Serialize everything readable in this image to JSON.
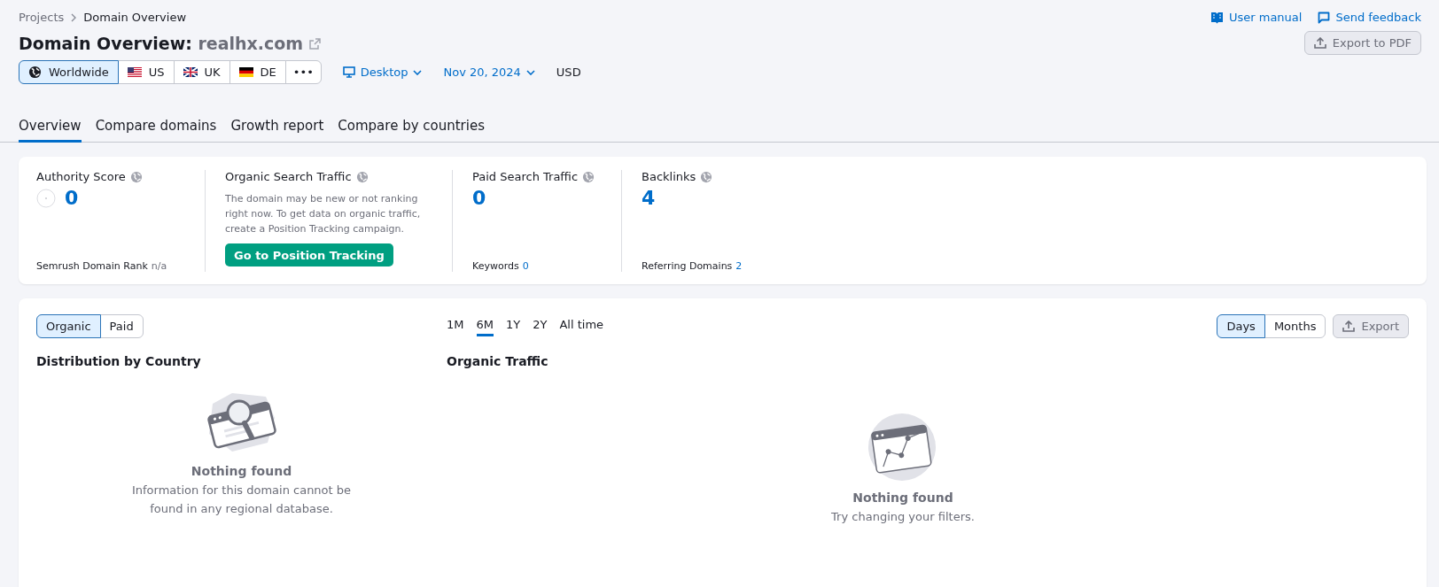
{
  "breadcrumb": [
    "Projects",
    "Domain Overview"
  ],
  "header_links": [
    {
      "label": "User manual",
      "kind": "manual"
    },
    {
      "label": "Send feedback",
      "kind": "feedback"
    }
  ],
  "title": {
    "label": "Domain Overview:",
    "domain": "realhx.com"
  },
  "export_pdf": "Export to PDF",
  "databases": [
    {
      "label": "Worldwide",
      "kind": "globe",
      "selected": true
    },
    {
      "label": "US",
      "kind": "us",
      "selected": false
    },
    {
      "label": "UK",
      "kind": "uk",
      "selected": false
    },
    {
      "label": "DE",
      "kind": "de",
      "selected": false
    },
    {
      "label": "•••",
      "kind": "more",
      "selected": false
    }
  ],
  "device": "Desktop",
  "date": "Nov 20, 2024",
  "currency": "USD",
  "tabs": [
    {
      "label": "Overview",
      "selected": true
    },
    {
      "label": "Compare domains",
      "selected": false
    },
    {
      "label": "Growth report",
      "selected": false
    },
    {
      "label": "Compare by countries",
      "selected": false
    }
  ],
  "metrics": [
    {
      "kind": "score",
      "title": "Authority Score",
      "value": "0",
      "footer_label": "Semrush Domain Rank",
      "footer_value": "n/a",
      "footer_link": false
    },
    {
      "kind": "message",
      "title": "Organic Search Traffic",
      "description": "The domain may be new or not ranking right now. To get data on organic traffic, create a Position Tracking campaign.",
      "button": "Go to Position Tracking"
    },
    {
      "kind": "value",
      "title": "Paid Search Traffic",
      "value": "0",
      "footer_label": "Keywords",
      "footer_value": "0",
      "footer_link": true
    },
    {
      "kind": "value",
      "title": "Backlinks",
      "value": "4",
      "footer_label": "Referring Domains",
      "footer_value": "2",
      "footer_link": true
    }
  ],
  "traffic_types": [
    {
      "label": "Organic",
      "selected": true
    },
    {
      "label": "Paid",
      "selected": false
    }
  ],
  "periods": [
    {
      "label": "1M",
      "selected": false
    },
    {
      "label": "6M",
      "selected": true
    },
    {
      "label": "1Y",
      "selected": false
    },
    {
      "label": "2Y",
      "selected": false
    },
    {
      "label": "All time",
      "selected": false
    }
  ],
  "granularity": [
    {
      "label": "Days",
      "selected": true
    },
    {
      "label": "Months",
      "selected": false
    }
  ],
  "export": "Export",
  "sections": [
    {
      "kind": "map",
      "title": "Distribution by Country",
      "empty_title": "Nothing found",
      "empty_text": "Information for this domain cannot be found in any regional database."
    },
    {
      "kind": "chart",
      "title": "Organic Traffic",
      "empty_title": "Nothing found",
      "empty_text": "Try changing your filters."
    }
  ]
}
